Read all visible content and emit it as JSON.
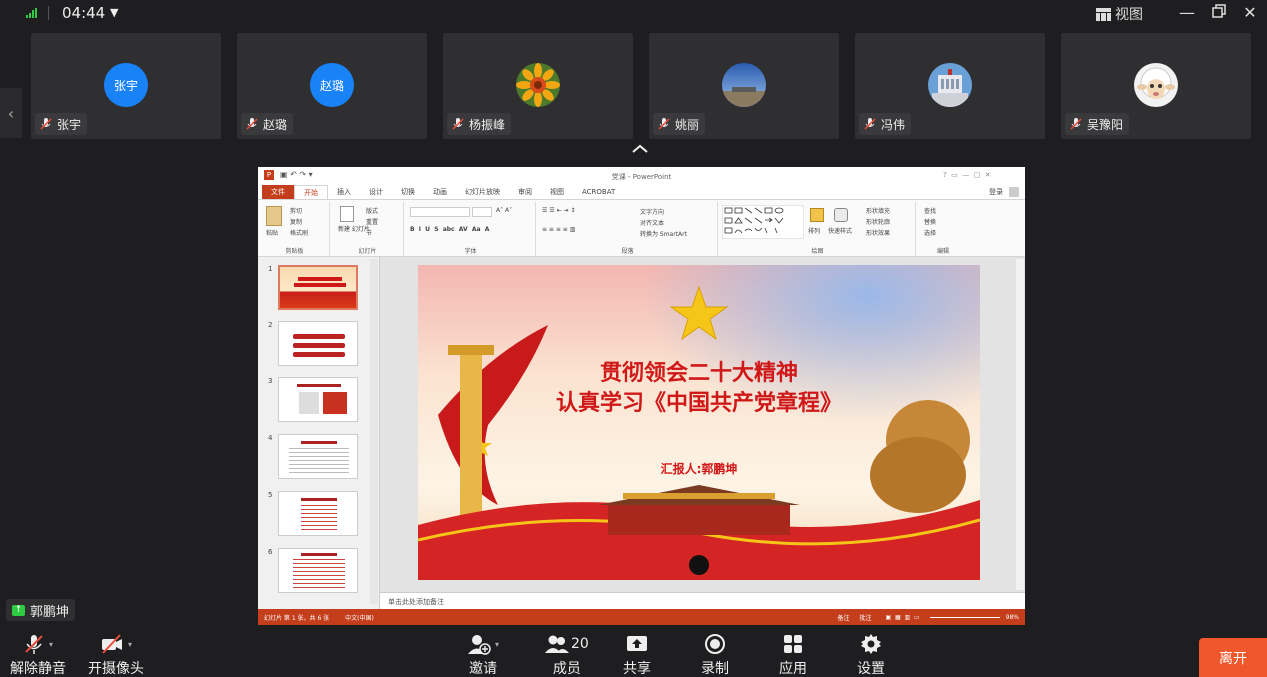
{
  "topbar": {
    "time": "04:44",
    "view_label": "视图"
  },
  "participants": [
    {
      "name": "张宇",
      "avatar_text": "张宇",
      "avatar_type": "initials"
    },
    {
      "name": "赵璐",
      "avatar_text": "赵璐",
      "avatar_type": "initials"
    },
    {
      "name": "杨振峰",
      "avatar_type": "photo-sunflower"
    },
    {
      "name": "姚丽",
      "avatar_type": "photo-sky"
    },
    {
      "name": "冯伟",
      "avatar_type": "photo-building"
    },
    {
      "name": "吴豫阳",
      "avatar_type": "photo-sheep"
    }
  ],
  "ppt": {
    "window_title": "党课 - PowerPoint",
    "login": "登录",
    "tabs": [
      "文件",
      "开始",
      "插入",
      "设计",
      "切换",
      "动画",
      "幻灯片放映",
      "审阅",
      "视图",
      "ACROBAT"
    ],
    "active_tab": "开始",
    "groups": [
      "剪贴板",
      "幻灯片",
      "字体",
      "段落",
      "绘图",
      "编辑"
    ],
    "clipboard": {
      "paste": "粘贴",
      "cut": "剪切",
      "copy": "复制",
      "format_painter": "格式刷"
    },
    "slides_group": {
      "new_slide": "新建\n幻灯片",
      "layout": "版式",
      "reset": "重置",
      "section": "节"
    },
    "paragraph": {
      "text_direction": "文字方向",
      "align_text": "对齐文本",
      "smartart": "转换为 SmartArt"
    },
    "drawing": {
      "arrange": "排列",
      "quick_styles": "快速样式",
      "shape_fill": "形状填充",
      "shape_outline": "形状轮廓",
      "shape_effects": "形状效果"
    },
    "editing": {
      "find": "查找",
      "replace": "替换",
      "select": "选择"
    },
    "thumb_numbers": [
      "1",
      "2",
      "3",
      "4",
      "5",
      "6"
    ],
    "slide": {
      "title_line1": "贯彻领会二十大精神",
      "title_line2": "认真学习《中国共产党章程》",
      "reporter": "汇报人:郭鹏坤"
    },
    "notes_placeholder": "单击此处添加备注",
    "status_left": "幻灯片 第 1 张，共 6 张",
    "status_lang": "中文(中国)",
    "status_notes": "备注",
    "status_comments": "批注",
    "zoom": "98%"
  },
  "self_name": "郭鹏坤",
  "toolbar": {
    "unmute": "解除静音",
    "camera": "开摄像头",
    "invite": "邀请",
    "members": "成员",
    "member_count": "20",
    "share": "共享",
    "record": "录制",
    "apps": "应用",
    "settings": "设置",
    "leave": "离开"
  },
  "colors": {
    "leave": "#f0572c",
    "ppt_accent": "#c43e1c",
    "avatar_blue": "#1a82f7",
    "signal": "#2ecc40"
  }
}
